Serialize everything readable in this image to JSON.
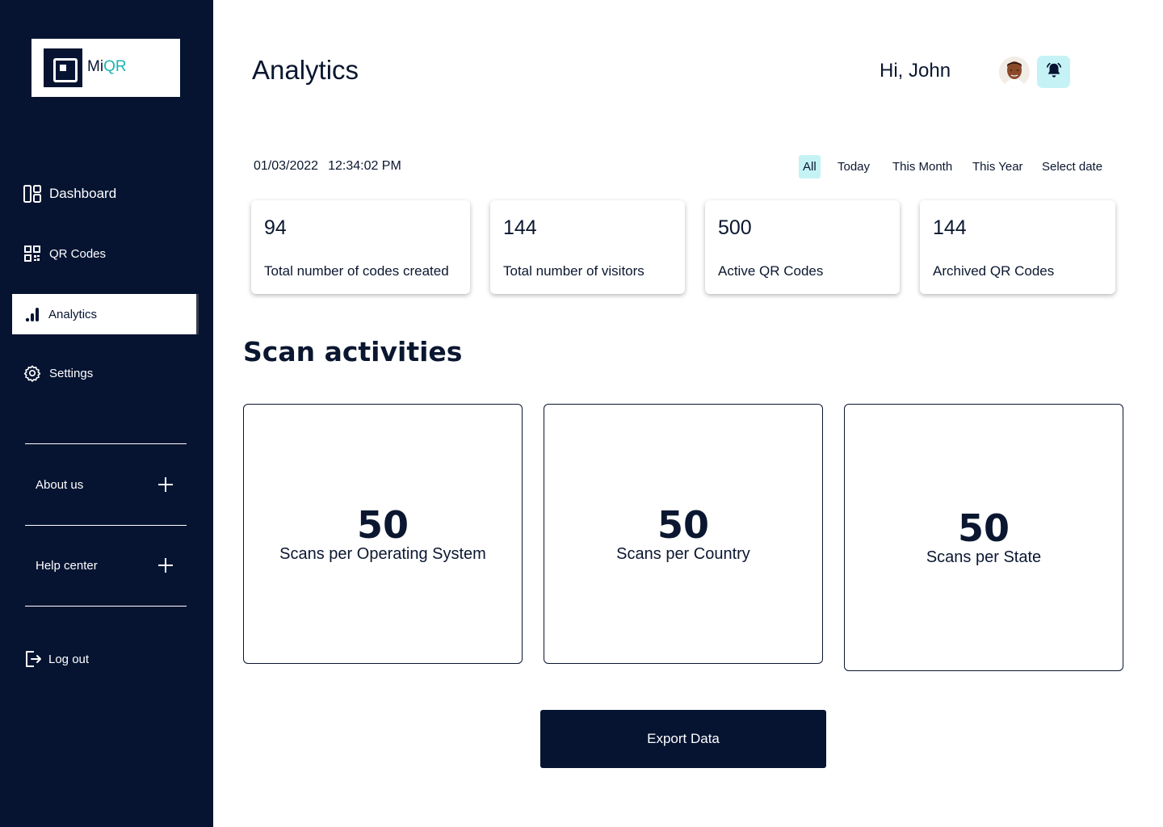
{
  "brand": {
    "logo_mi": "Mi",
    "logo_qr": "QR"
  },
  "sidebar": {
    "items": [
      {
        "label": "Dashboard",
        "icon": "dashboard-icon"
      },
      {
        "label": "QR Codes",
        "icon": "qr-code-icon"
      },
      {
        "label": "Analytics",
        "icon": "bar-chart-icon",
        "active": true
      },
      {
        "label": "Settings",
        "icon": "gear-icon"
      }
    ],
    "accordion": [
      {
        "label": "About us",
        "icon": "plus-icon"
      },
      {
        "label": "Help center",
        "icon": "plus-icon"
      }
    ],
    "logout_label": "Log out"
  },
  "header": {
    "title": "Analytics",
    "greeting": "Hi, John"
  },
  "datetime": {
    "date": "01/03/2022",
    "time": "12:34:02 PM"
  },
  "filters": [
    {
      "label": "All",
      "active": true
    },
    {
      "label": "Today"
    },
    {
      "label": "This Month"
    },
    {
      "label": "This Year"
    },
    {
      "label": "Select date"
    }
  ],
  "stats": [
    {
      "value": "94",
      "label": "Total number of codes created"
    },
    {
      "value": "144",
      "label": "Total number of visitors"
    },
    {
      "value": "500",
      "label": "Active QR Codes"
    },
    {
      "value": "144",
      "label": "Archived QR Codes"
    }
  ],
  "scan_section": {
    "title": "Scan activities",
    "cards": [
      {
        "value": "50",
        "label": "Scans per Operating System"
      },
      {
        "value": "50",
        "label": "Scans per Country"
      },
      {
        "value": "50",
        "label": "Scans per State"
      }
    ]
  },
  "export_label": "Export Data",
  "colors": {
    "sidebar": "#061432",
    "accent": "#1bb3b3",
    "highlight": "#c5f3f5"
  }
}
